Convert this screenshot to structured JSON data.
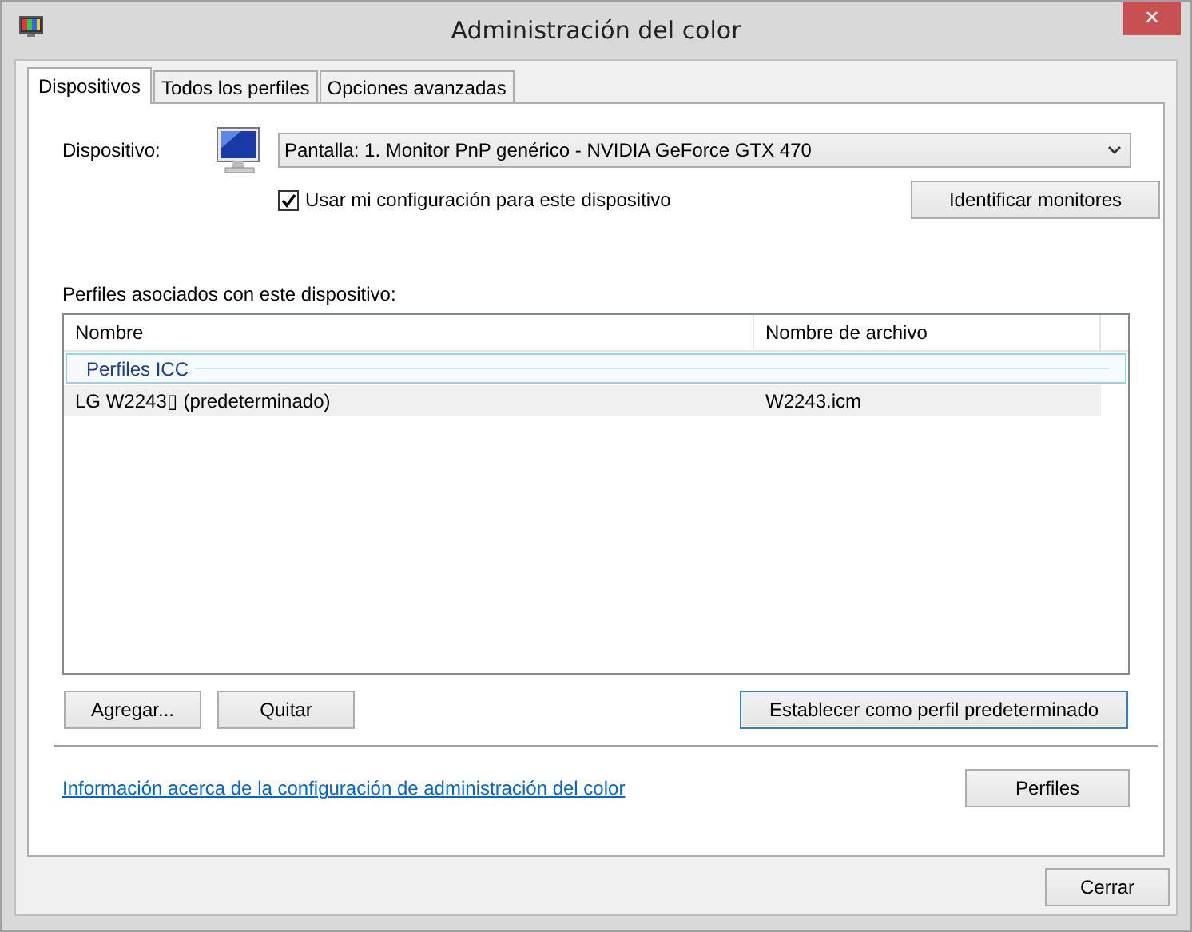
{
  "window": {
    "title": "Administración del color",
    "close_glyph": "✕"
  },
  "tabs": [
    {
      "label": "Dispositivos",
      "selected": true
    },
    {
      "label": "Todos los perfiles",
      "selected": false
    },
    {
      "label": "Opciones avanzadas",
      "selected": false
    }
  ],
  "device": {
    "label": "Dispositivo:",
    "value": "Pantalla: 1. Monitor PnP genérico - NVIDIA GeForce GTX 470",
    "use_my_settings": {
      "label": "Usar mi configuración para este dispositivo",
      "checked": true
    },
    "identify_button": "Identificar monitores"
  },
  "profiles": {
    "label": "Perfiles asociados con este dispositivo:",
    "columns": [
      "Nombre",
      "Nombre de archivo"
    ],
    "groups": [
      {
        "name": "Perfiles ICC",
        "rows": [
          {
            "name": "LG W2243▯ (predeterminado)",
            "file": "W2243.icm",
            "selected": true
          }
        ]
      }
    ],
    "buttons": [
      {
        "label": "Agregar...",
        "default": false
      },
      {
        "label": "Quitar",
        "default": false
      },
      {
        "label": "Establecer como perfil predeterminado",
        "default": true
      }
    ]
  },
  "info_link": "Información acerca de la configuración de administración del color",
  "profiles_button": "Perfiles",
  "close_button": "Cerrar"
}
